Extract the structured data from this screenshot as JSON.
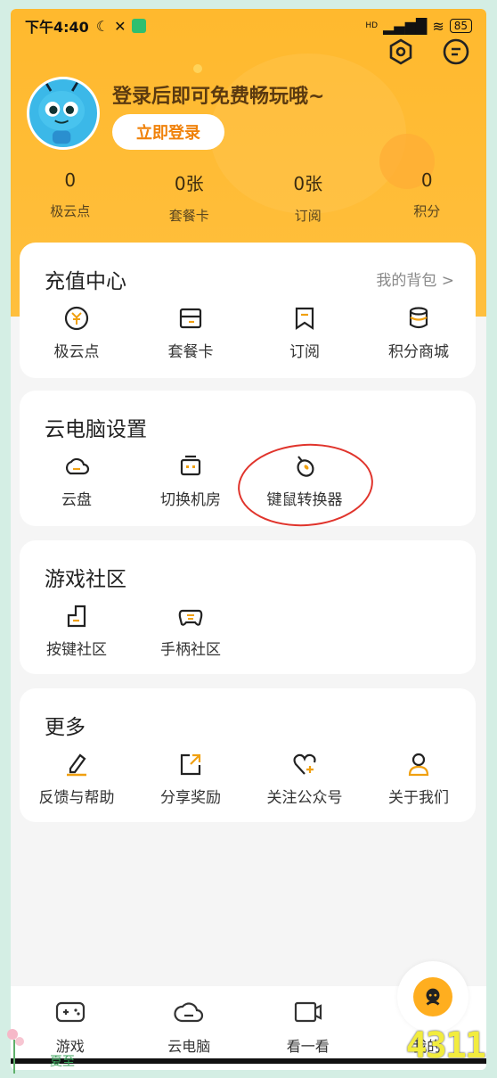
{
  "status_bar": {
    "time": "下午4:40",
    "signal_badge": "HD",
    "battery": "85"
  },
  "header": {
    "login_prompt": "登录后即可免费畅玩哦~",
    "login_button": "立即登录",
    "icons": [
      "settings-hex-icon",
      "message-icon"
    ]
  },
  "stats": [
    {
      "value": "0",
      "label": "极云点"
    },
    {
      "value": "0张",
      "label": "套餐卡"
    },
    {
      "value": "0张",
      "label": "订阅"
    },
    {
      "value": "0",
      "label": "积分"
    }
  ],
  "recharge": {
    "title": "充值中心",
    "link": "我的背包 >",
    "items": [
      {
        "label": "极云点",
        "icon": "coin-icon"
      },
      {
        "label": "套餐卡",
        "icon": "card-icon"
      },
      {
        "label": "订阅",
        "icon": "bookmark-icon"
      },
      {
        "label": "积分商城",
        "icon": "database-icon"
      }
    ]
  },
  "cloud_settings": {
    "title": "云电脑设置",
    "items": [
      {
        "label": "云盘",
        "icon": "cloud-icon"
      },
      {
        "label": "切换机房",
        "icon": "server-icon"
      },
      {
        "label": "键鼠转换器",
        "icon": "mouse-icon"
      }
    ]
  },
  "community": {
    "title": "游戏社区",
    "items": [
      {
        "label": "按键社区",
        "icon": "key-icon"
      },
      {
        "label": "手柄社区",
        "icon": "gamepad-icon"
      }
    ]
  },
  "more": {
    "title": "更多",
    "items": [
      {
        "label": "反馈与帮助",
        "icon": "edit-icon"
      },
      {
        "label": "分享奖励",
        "icon": "share-icon"
      },
      {
        "label": "关注公众号",
        "icon": "heart-icon"
      },
      {
        "label": "关于我们",
        "icon": "person-icon"
      }
    ]
  },
  "tabbar": [
    {
      "label": "游戏",
      "icon": "gamepad-tab-icon"
    },
    {
      "label": "云电脑",
      "icon": "cloud-tab-icon"
    },
    {
      "label": "看一看",
      "icon": "video-icon"
    },
    {
      "label": "我的",
      "icon": "mine-icon"
    }
  ],
  "overlay": {
    "watermark": "4311",
    "season_text": "夏至"
  },
  "colors": {
    "brand": "#ffb92e",
    "accent": "#f0820a",
    "annotation": "#e0342c"
  }
}
